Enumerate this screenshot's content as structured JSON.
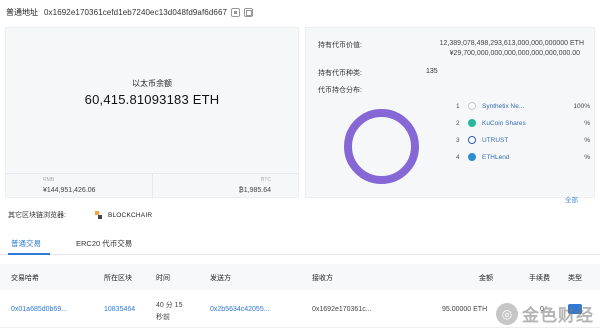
{
  "header": {
    "label": "普通地址",
    "address": "0x1692e170361cefd1eb7240ec13d048fd9af6d667"
  },
  "balance": {
    "title": "以太币余额",
    "value": "60,415.81093183 ETH",
    "rmb_label": "RMB",
    "rmb_value": "¥144,951,426.06",
    "btc_label": "BTC",
    "btc_value": "₿1,985.64"
  },
  "holdings": {
    "value_label": "持有代币价值:",
    "value_eth": "12,389,078,498,293,613,000,000,000000 ETH",
    "value_cny": "¥29,700,000,000,000,000,000,000,000.00",
    "count_label": "持有代币种类:",
    "count": "135",
    "dist_label": "代币持仓分布:",
    "donut_color": "#8667d6",
    "tokens": [
      {
        "rank": "1",
        "name": "Synthetix Ne...",
        "pct": "100%"
      },
      {
        "rank": "2",
        "name": "KuCoin Shares",
        "pct": "%"
      },
      {
        "rank": "3",
        "name": "UTRUST",
        "pct": "%"
      },
      {
        "rank": "4",
        "name": "ETHLend",
        "pct": "%"
      }
    ],
    "more": "全部"
  },
  "explorer": {
    "label": "其它区块链浏览器:",
    "name": "BLOCKCHAIR"
  },
  "tabs": [
    "普通交易",
    "ERC20 代币交易"
  ],
  "table": {
    "headers": [
      "交易哈希",
      "所在区块",
      "时间",
      "发送方",
      "接收方",
      "金额",
      "手续费",
      "类型"
    ],
    "row": {
      "hash": "0x01a685d0b69...",
      "block": "10835464",
      "time_line1": "40 分 15",
      "time_line2": "秒前",
      "from": "0x2b5634c42055...",
      "to": "0x1692e170361c...",
      "amount": "95.00000 ETH",
      "fee": "0",
      "type": ""
    }
  },
  "watermark": "金色财经"
}
